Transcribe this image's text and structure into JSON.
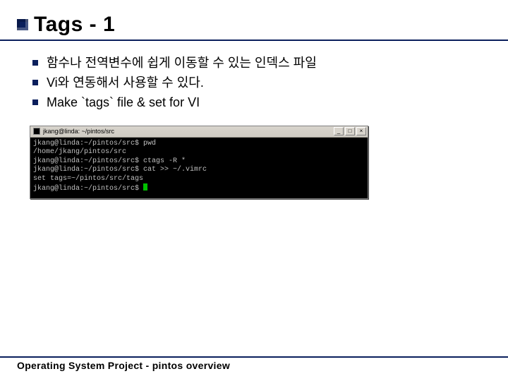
{
  "title": "Tags - 1",
  "bullets": [
    "함수나 전역변수에 쉽게 이동할 수 있는 인덱스 파일",
    "Vi와 연동해서 사용할 수 있다.",
    "Make `tags` file & set for VI"
  ],
  "terminal": {
    "title": "jkang@linda: ~/pintos/src",
    "min": "_",
    "max": "□",
    "close": "×",
    "lines": [
      "jkang@linda:~/pintos/src$ pwd",
      "/home/jkang/pintos/src",
      "jkang@linda:~/pintos/src$ ctags -R *",
      "jkang@linda:~/pintos/src$ cat >> ~/.vimrc",
      "set tags=~/pintos/src/tags",
      "jkang@linda:~/pintos/src$ "
    ]
  },
  "footer": "Operating System Project - pintos overview"
}
